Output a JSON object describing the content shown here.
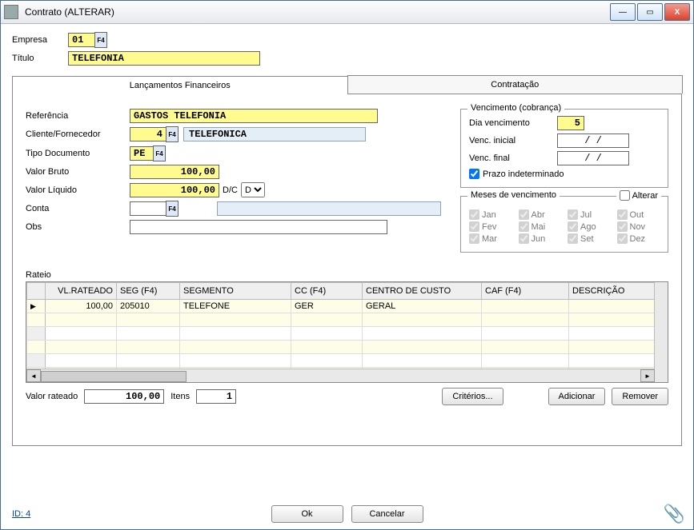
{
  "window": {
    "title": "Contrato (ALTERAR)"
  },
  "header": {
    "empresa_label": "Empresa",
    "empresa_value": "01",
    "titulo_label": "Título",
    "titulo_value": "TELEFONIA"
  },
  "tabs": {
    "financeiro": "Lançamentos Financeiros",
    "contratacao": "Contratação"
  },
  "financeiro": {
    "referencia_label": "Referência",
    "referencia_value": "GASTOS TELEFONIA",
    "cliente_label": "Cliente/Fornecedor",
    "cliente_code": "4",
    "cliente_nome": "TELEFONICA",
    "tipo_doc_label": "Tipo Documento",
    "tipo_doc_value": "PE",
    "valor_bruto_label": "Valor Bruto",
    "valor_bruto_value": "100,00",
    "valor_liquido_label": "Valor Líquido",
    "valor_liquido_value": "100,00",
    "dc_label": "D/C",
    "dc_value": "D",
    "conta_label": "Conta",
    "conta_value": "",
    "conta_desc": "",
    "obs_label": "Obs",
    "obs_value": ""
  },
  "vencimento": {
    "legend": "Vencimento (cobrança)",
    "dia_label": "Dia vencimento",
    "dia_value": "5",
    "inicial_label": "Venc. inicial",
    "inicial_value": "  /   /",
    "final_label": "Venc. final",
    "final_value": "  /   /",
    "indeterminado_label": "Prazo indeterminado"
  },
  "meses": {
    "legend": "Meses de vencimento",
    "alterar_label": "Alterar",
    "items": [
      "Jan",
      "Abr",
      "Jul",
      "Out",
      "Fev",
      "Mai",
      "Ago",
      "Nov",
      "Mar",
      "Jun",
      "Set",
      "Dez"
    ]
  },
  "rateio": {
    "label": "Rateio",
    "columns": [
      "VL.RATEADO",
      "SEG (F4)",
      "SEGMENTO",
      "CC (F4)",
      "CENTRO DE CUSTO",
      "CAF (F4)",
      "DESCRIÇÃO"
    ],
    "rows": [
      {
        "vl": "100,00",
        "seg": "205010",
        "segmento": "TELEFONE",
        "cc": "GER",
        "centro": "GERAL",
        "caf": "",
        "desc": ""
      }
    ],
    "valor_rateado_label": "Valor rateado",
    "valor_rateado_value": "100,00",
    "itens_label": "Itens",
    "itens_value": "1",
    "criterios_btn": "Critérios...",
    "adicionar_btn": "Adicionar",
    "remover_btn": "Remover"
  },
  "footer": {
    "ok": "Ok",
    "cancelar": "Cancelar",
    "id": "ID: 4"
  }
}
